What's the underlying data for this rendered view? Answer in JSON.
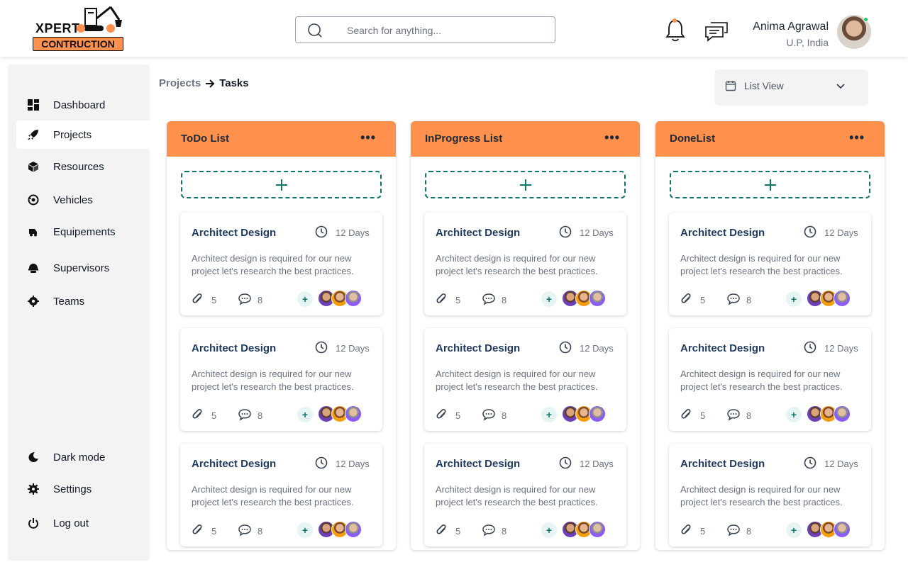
{
  "brand": {
    "line1": "XPERT",
    "line2": "CONTRUCTION",
    "accent": "#ff914d"
  },
  "search": {
    "placeholder": "Search for anything..."
  },
  "header_icons": [
    "bell-icon",
    "chat-icon"
  ],
  "user": {
    "name": "Anima Agrawal",
    "location": "U.P, India",
    "online": true
  },
  "sidebar": {
    "items": [
      {
        "label": "Dashboard",
        "icon": "dashboard-icon",
        "active": false
      },
      {
        "label": "Projects",
        "icon": "rocket-icon",
        "active": true
      },
      {
        "label": "Resources",
        "icon": "cube-icon",
        "active": false
      },
      {
        "label": "Vehicles",
        "icon": "vehicle-icon",
        "active": false
      },
      {
        "label": "Equipements",
        "icon": "equipment-icon",
        "active": false
      },
      {
        "label": "Supervisors",
        "icon": "helmet-icon",
        "active": false
      },
      {
        "label": "Teams",
        "icon": "teams-icon",
        "active": false
      }
    ],
    "bottom": [
      {
        "label": "Dark mode",
        "icon": "moon-icon"
      },
      {
        "label": "Settings",
        "icon": "gear-icon"
      },
      {
        "label": "Log out",
        "icon": "power-icon"
      }
    ]
  },
  "breadcrumb": {
    "parent": "Projects",
    "current": "Tasks"
  },
  "view_selector": {
    "label": "List View"
  },
  "columns": [
    {
      "title": "ToDo List",
      "cards": [
        {
          "title": "Architect Design",
          "days": "12 Days",
          "desc": "Architect design is required for our new project let's research the best practices.",
          "attachments": "5",
          "comments": "8"
        },
        {
          "title": "Architect Design",
          "days": "12 Days",
          "desc": "Architect design is required for our new project let's research the best practices.",
          "attachments": "5",
          "comments": "8"
        },
        {
          "title": "Architect Design",
          "days": "12 Days",
          "desc": "Architect design is required for our new project let's research the best practices.",
          "attachments": "5",
          "comments": "8"
        }
      ]
    },
    {
      "title": "InProgress List",
      "cards": [
        {
          "title": "Architect Design",
          "days": "12 Days",
          "desc": "Architect design is required for our new project let's research the best practices.",
          "attachments": "5",
          "comments": "8"
        },
        {
          "title": "Architect Design",
          "days": "12 Days",
          "desc": "Architect design is required for our new project let's research the best practices.",
          "attachments": "5",
          "comments": "8"
        },
        {
          "title": "Architect Design",
          "days": "12 Days",
          "desc": "Architect design is required for our new project let's research the best practices.",
          "attachments": "5",
          "comments": "8"
        }
      ]
    },
    {
      "title": "DoneList",
      "cards": [
        {
          "title": "Architect Design",
          "days": "12 Days",
          "desc": "Architect design is required for our new project let's research the best practices.",
          "attachments": "5",
          "comments": "8"
        },
        {
          "title": "Architect Design",
          "days": "12 Days",
          "desc": "Architect design is required for our new project let's research the best practices.",
          "attachments": "5",
          "comments": "8"
        },
        {
          "title": "Architect Design",
          "days": "12 Days",
          "desc": "Architect design is required for our new project let's research the best practices.",
          "attachments": "5",
          "comments": "8"
        }
      ]
    }
  ]
}
